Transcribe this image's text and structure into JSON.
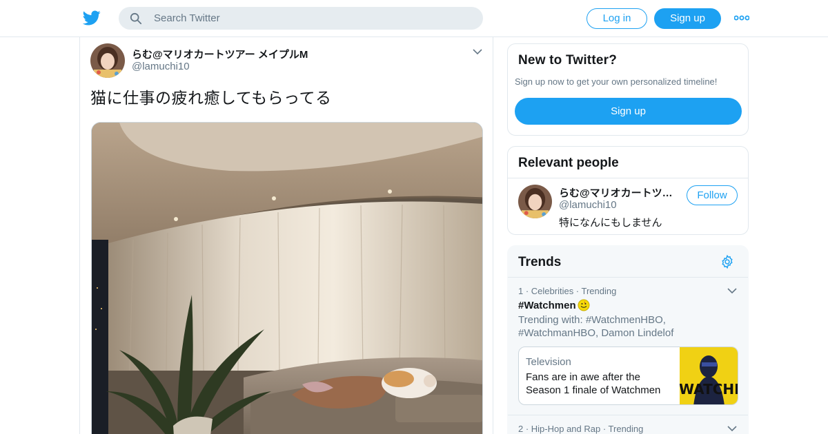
{
  "header": {
    "logo_icon": "twitter-bird-icon",
    "search_placeholder": "Search Twitter",
    "login_label": "Log in",
    "signup_label": "Sign up",
    "more_icon": "more-dots-icon",
    "accent": "#1da1f2"
  },
  "tweet": {
    "author_name": "らむ@マリオカートツアー メイプルM",
    "author_handle": "@lamuchi10",
    "text": "猫に仕事の疲れ癒してもらってる",
    "caret_icon": "chevron-down-icon",
    "photo_alt": "cat-on-sofa-photo"
  },
  "new_to_twitter": {
    "title": "New to Twitter?",
    "subtitle": "Sign up now to get your own personalized timeline!",
    "signup_label": "Sign up"
  },
  "relevant_people": {
    "title": "Relevant people",
    "person": {
      "name": "らむ@マリオカートツ…",
      "handle": "@lamuchi10",
      "bio": "特になんにもしません",
      "follow_label": "Follow"
    }
  },
  "trends": {
    "title": "Trends",
    "settings_icon": "gear-icon",
    "items": [
      {
        "meta": "1 · Celebrities · Trending",
        "name": "#Watchmen",
        "emoji_icon": "watchmen-smiley-icon",
        "trending_with": "Trending with: #WatchmenHBO, #WatchmanHBO, Damon Lindelof",
        "story": {
          "category": "Television",
          "headline": "Fans are in awe after the Season 1 finale of Watchmen",
          "image_text": "WATCHMEN"
        }
      },
      {
        "meta": "2 · Hip-Hop and Rap · Trending"
      }
    ]
  }
}
